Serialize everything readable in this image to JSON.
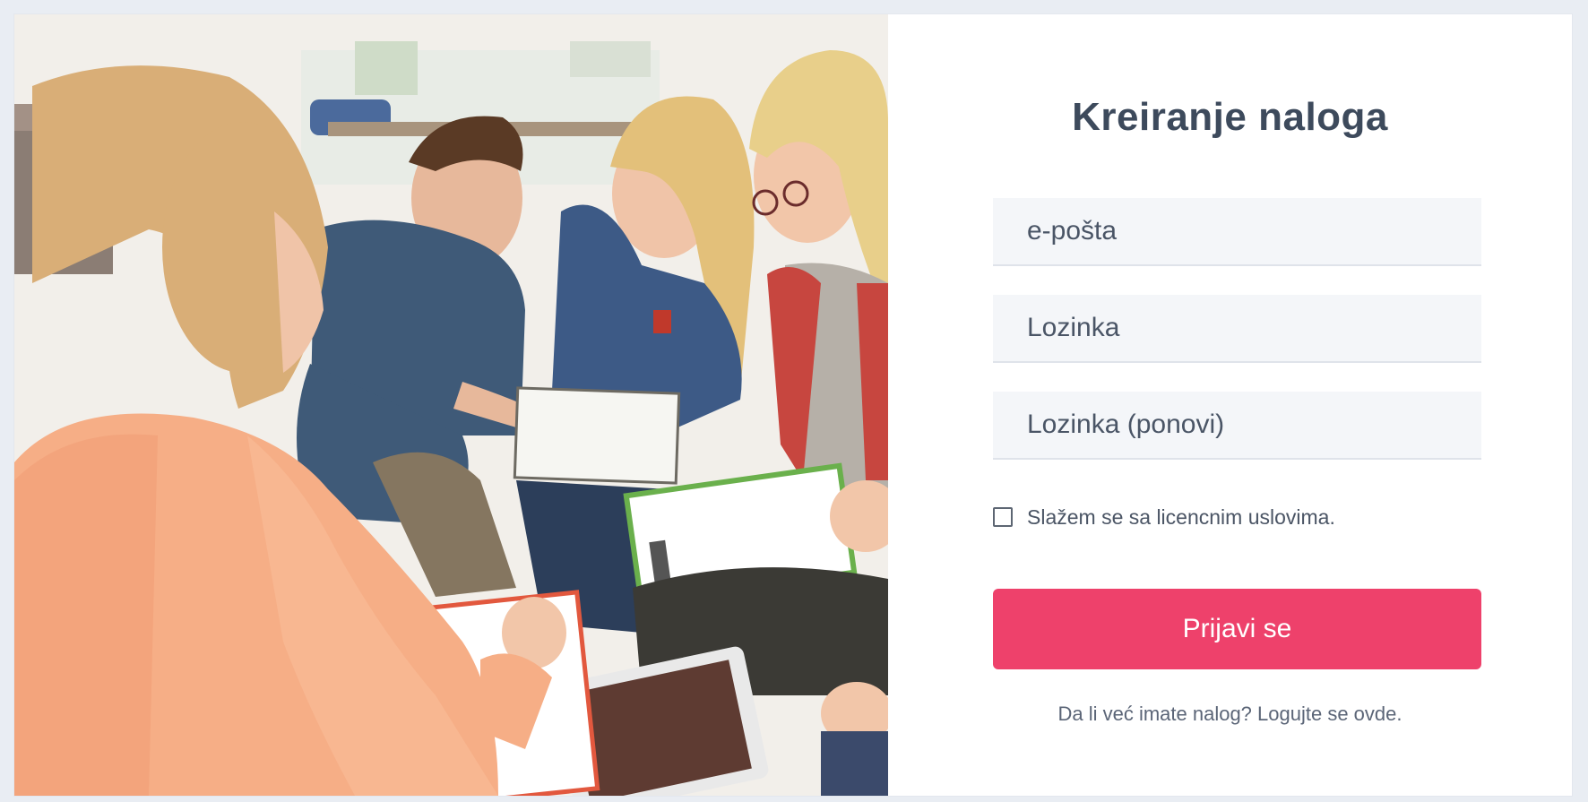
{
  "form": {
    "title": "Kreiranje naloga",
    "email_placeholder": "e-pošta",
    "password_placeholder": "Lozinka",
    "password_repeat_placeholder": "Lozinka (ponovi)",
    "terms_label": "Slažem se sa licencnim uslovima.",
    "terms_checked": false,
    "submit_label": "Prijavi se",
    "login_prompt": "Da li već imate nalog?",
    "login_link": "Logujte se ovde."
  },
  "colors": {
    "accent": "#ee416b",
    "title": "#3d4a5c",
    "field_background": "#f4f6f9",
    "page_background": "#e9edf3"
  }
}
